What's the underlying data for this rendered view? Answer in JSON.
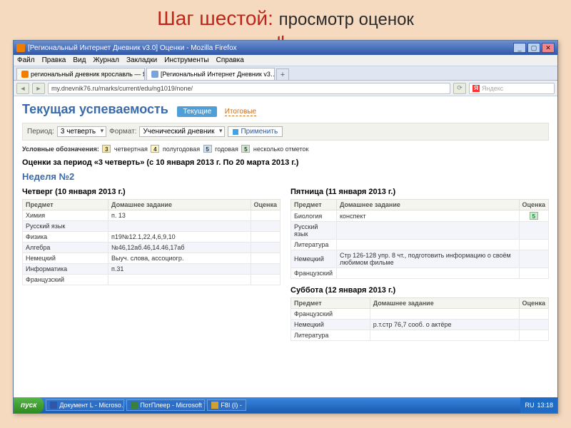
{
  "slide": {
    "title_red": "Шаг шестой:",
    "title_black": "просмотр оценок"
  },
  "titlebar": {
    "text": "[Региональный Интернет Дневник v3.0] Оценки - Mozilla Firefox"
  },
  "window_controls": {
    "min": "_",
    "max": "▢",
    "close": "✕"
  },
  "menu": {
    "file": "Файл",
    "edit": "Правка",
    "view": "Вид",
    "journal": "Журнал",
    "bookmarks": "Закладки",
    "tools": "Инструменты",
    "help": "Справка"
  },
  "tabs": {
    "t1": "региональный дневник ярославль — Я…",
    "t2": "[Региональный Интернет Дневник v3…",
    "plus": "+"
  },
  "addr": {
    "url": "my.dnevnik76.ru/marks/current/edu/ng1019/none/",
    "search_placeholder": "Яндекс"
  },
  "page_head": {
    "title": "Текущая успеваемость",
    "tab_current": "Текущие",
    "tab_final": "Итоговые"
  },
  "filter": {
    "period_lbl": "Период:",
    "period_val": "3 четверть",
    "format_lbl": "Формат:",
    "format_val": "Ученический дневник",
    "apply": "Применить"
  },
  "legend": {
    "prefix": "Условные обозначения:",
    "q": "четвертная",
    "h": "полугодовая",
    "y": "годовая",
    "m": "несколько отметок",
    "n3": "3",
    "n4": "4",
    "n5b": "5",
    "n5g": "5"
  },
  "sub": {
    "period": "Оценки за период «3 четверть» (с 10 января 2013 г. По 20 марта 2013 г.)",
    "week": "Неделя №2"
  },
  "cols": {
    "subj": "Предмет",
    "hw": "Домашнее задание",
    "grade": "Оценка"
  },
  "thu": {
    "title": "Четверг (10 января 2013 г.)",
    "rows": [
      {
        "subj": "Химия",
        "hw": "п. 13",
        "g": ""
      },
      {
        "subj": "Русский язык",
        "hw": "",
        "g": ""
      },
      {
        "subj": "Физика",
        "hw": "п19№12.1,22,4,6,9,10",
        "g": ""
      },
      {
        "subj": "Алгебра",
        "hw": "№46,12аб.46,14.46,17аб",
        "g": ""
      },
      {
        "subj": "Немецкий",
        "hw": "Выуч. слова, ассоциогр.",
        "g": ""
      },
      {
        "subj": "Информатика",
        "hw": "п.31",
        "g": ""
      },
      {
        "subj": "Французский",
        "hw": "",
        "g": ""
      }
    ]
  },
  "fri": {
    "title": "Пятница (11 января 2013 г.)",
    "rows": [
      {
        "subj": "Биология",
        "hw": "конспект",
        "g": "5"
      },
      {
        "subj": "Русский язык",
        "hw": "",
        "g": ""
      },
      {
        "subj": "Литература",
        "hw": "",
        "g": ""
      },
      {
        "subj": "Немецкий",
        "hw": "Стр 126-128 упр. 8 чт., подготовить информацию о своём любимом фильме",
        "g": ""
      },
      {
        "subj": "Французский",
        "hw": "",
        "g": ""
      }
    ]
  },
  "sat": {
    "title": "Суббота (12 января 2013 г.)",
    "rows": [
      {
        "subj": "Французский",
        "hw": "",
        "g": ""
      },
      {
        "subj": "Немецкий",
        "hw": "р.т.стр 76,7 сооб. о актёре",
        "g": ""
      },
      {
        "subj": "Литература",
        "hw": "",
        "g": ""
      }
    ]
  },
  "taskbar": {
    "start": "пуск",
    "items": [
      {
        "label": "Документ L - Microso…",
        "color": "#2f56a8"
      },
      {
        "label": "ПотПлеер - Microsoft W…",
        "color": "#3a7f3a"
      },
      {
        "label": "F8I (I) -",
        "color": "#d0a030"
      }
    ],
    "lang": "RU",
    "time": "13:18"
  }
}
